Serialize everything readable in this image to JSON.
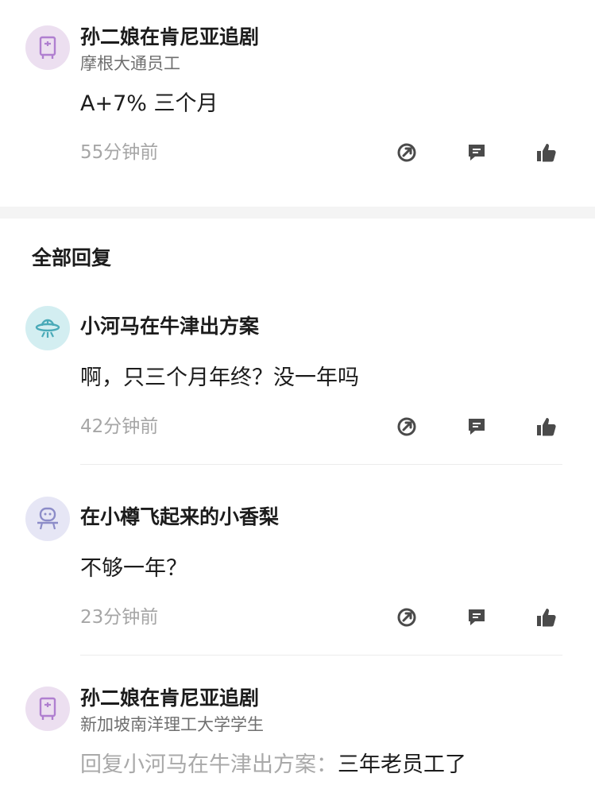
{
  "original_post": {
    "username": "孙二娘在肯尼亚追剧",
    "subtitle": "摩根大通员工",
    "text": "A+7% 三个月",
    "time": "55分钟前"
  },
  "section": {
    "title": "全部回复"
  },
  "replies": [
    {
      "username": "小河马在牛津出方案",
      "text": "啊，只三个月年终？没一年吗",
      "time": "42分钟前"
    },
    {
      "username": "在小樽飞起来的小香梨",
      "text": "不够一年？",
      "time": "23分钟前"
    },
    {
      "username": "孙二娘在肯尼亚追剧",
      "subtitle": "新加坡南洋理工大学学生",
      "reply_prefix": "回复小河马在牛津出方案：",
      "text": "三年老员工了"
    }
  ],
  "icons": {
    "share": "share-icon",
    "comment": "comment-icon",
    "like": "thumbs-up-icon"
  },
  "colors": {
    "action_icon": "#4a4a4a",
    "avatar_purple": "#b07fd0",
    "avatar_cyan": "#4aaab8",
    "avatar_lavender": "#8c8cc8"
  }
}
